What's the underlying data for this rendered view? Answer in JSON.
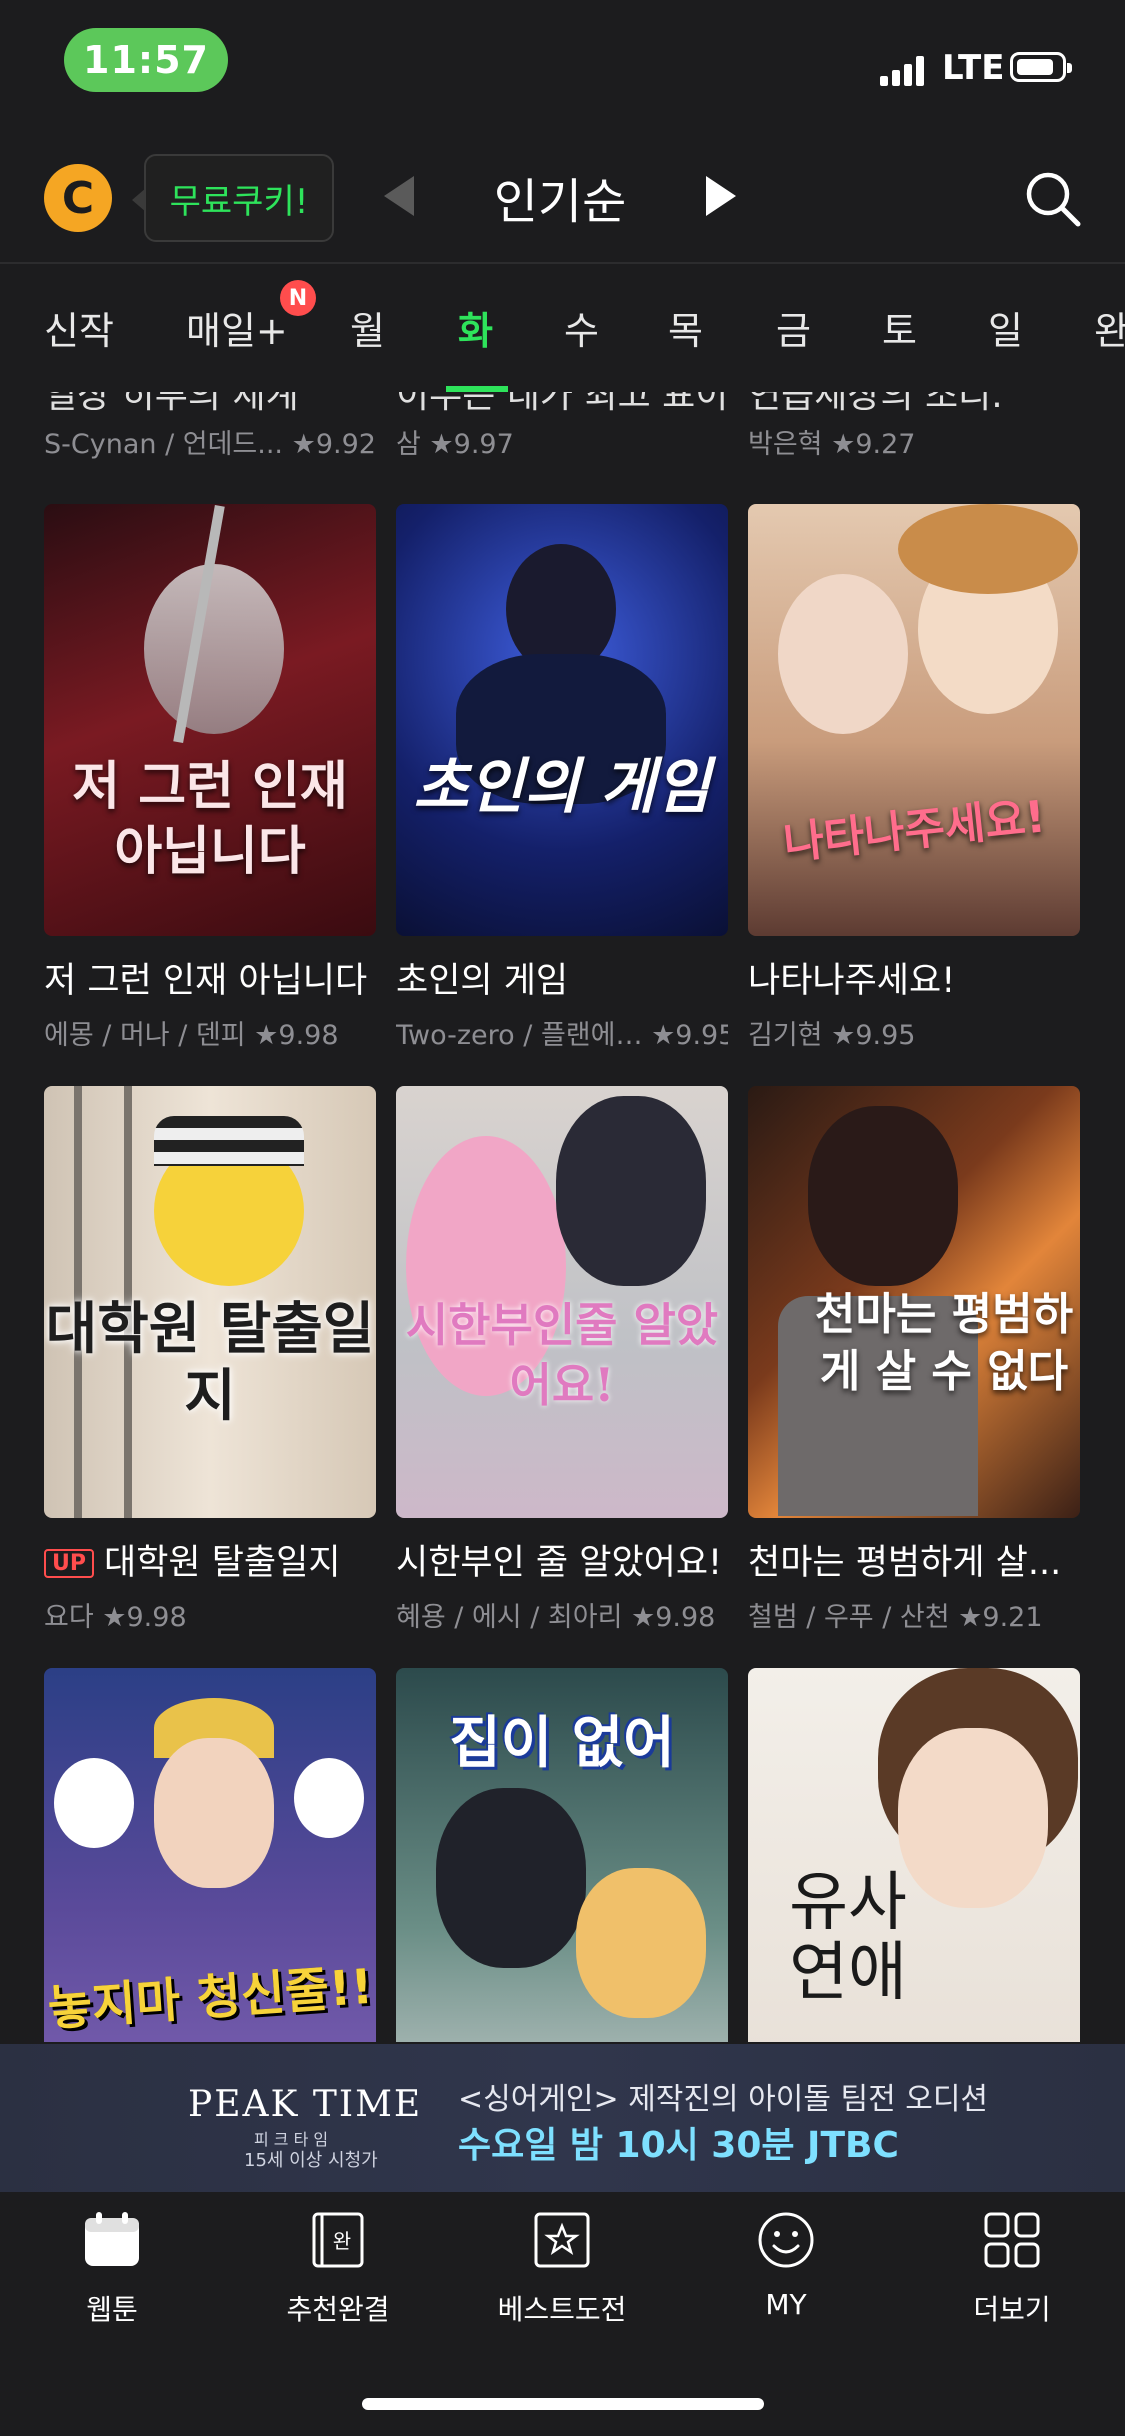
{
  "status_bar": {
    "time": "11:57",
    "network": "LTE"
  },
  "header": {
    "logo_letter": "C",
    "cookie_label": "무료쿠키!",
    "sort_title": "인기순"
  },
  "day_tabs": [
    {
      "label": "신작"
    },
    {
      "label": "매일+"
    },
    {
      "label": "월"
    },
    {
      "label": "화"
    },
    {
      "label": "수"
    },
    {
      "label": "목"
    },
    {
      "label": "금"
    },
    {
      "label": "토"
    },
    {
      "label": "일"
    },
    {
      "label": "완"
    }
  ],
  "new_badge": "N",
  "partial_row": [
    {
      "title": "일상 히루의 세계",
      "meta": "S-Cynan / 언데드...",
      "rating": "9.92"
    },
    {
      "title": "이무슨 네가 최고 표이",
      "meta": "삼",
      "rating": "9.97"
    },
    {
      "title": "연습세상의 조리.",
      "meta": "박은혁",
      "rating": "9.27"
    }
  ],
  "cards": [
    {
      "title": "저 그런 인재 아닙니다",
      "meta": "에몽 / 머나 / 덴피",
      "rating": "9.98",
      "art": "저 그런 인재 아닙니다"
    },
    {
      "title": "초인의 게임",
      "meta": "Two-zero / 플랜에…",
      "rating": "9.95",
      "art": "초인의 게임"
    },
    {
      "title": "나타나주세요!",
      "meta": "김기현",
      "rating": "9.95",
      "art": "나타나주세요!"
    },
    {
      "title": "대학원 탈출일지",
      "meta": "요다",
      "rating": "9.98",
      "art": "대학원 탈출일지",
      "badge": "UP"
    },
    {
      "title": "시한부인 줄 알았어요!",
      "meta": "혜용 / 에시 / 최아리",
      "rating": "9.98",
      "art": "시한부인줄 알았어요!"
    },
    {
      "title": "천마는 평범하게 살...",
      "meta": "철범 / 우푸 / 산천",
      "rating": "9.21",
      "art": "천마는 평범하게 살 수 없다"
    },
    {
      "title": "",
      "meta": "",
      "rating": "",
      "art": "놓지마 청신줄!!"
    },
    {
      "title": "",
      "meta": "",
      "rating": "",
      "art": "집이 없어"
    },
    {
      "title": "",
      "meta": "",
      "rating": "",
      "art": "유사 연애"
    }
  ],
  "ad": {
    "logo": "PEAK TIME",
    "logo_sub": "피 크 타 임",
    "age": "15세 이상 시청가",
    "line1": "<싱어게인> 제작진의 아이돌 팀전 오디션",
    "line2": "수요일 밤 10시 30분 JTBC"
  },
  "bottom_nav": [
    {
      "label": "웹툰",
      "icon": "calendar-icon"
    },
    {
      "label": "추천완결",
      "icon": "book-icon"
    },
    {
      "label": "베스트도전",
      "icon": "star-icon"
    },
    {
      "label": "MY",
      "icon": "smiley-icon"
    },
    {
      "label": "더보기",
      "icon": "grid-icon"
    }
  ],
  "colors": {
    "accent": "#2ee35b",
    "background": "#1c1c1e",
    "badge": "#ff4d4d"
  }
}
